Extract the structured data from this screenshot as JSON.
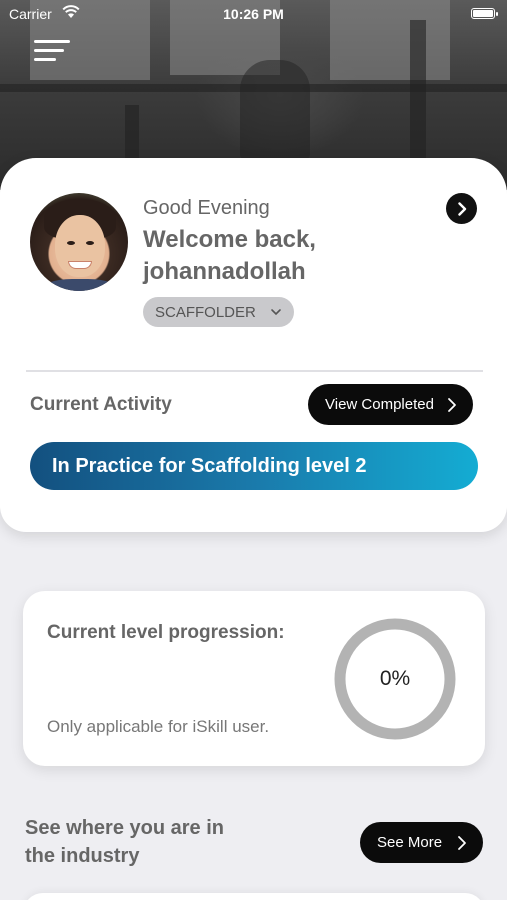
{
  "status_bar": {
    "carrier": "Carrier",
    "time": "10:26 PM"
  },
  "profile": {
    "greeting": "Good Evening",
    "welcome": "Welcome back,",
    "username": "johannadollah",
    "role": "SCAFFOLDER"
  },
  "activity": {
    "section_label": "Current Activity",
    "view_completed_label": "View Completed",
    "current": "In Practice for Scaffolding level 2"
  },
  "progression": {
    "title": "Current level progression:",
    "percent": 0,
    "percent_label": "0%",
    "note": "Only applicable for iSkill user."
  },
  "industry": {
    "line1": "See where you are in",
    "line2": "the industry",
    "see_more_label": "See More"
  },
  "colors": {
    "activity_gradient_start": "#13507f",
    "activity_gradient_end": "#14acd3",
    "button_bg": "#0b0b0b",
    "ring": "#b3b3b3"
  }
}
